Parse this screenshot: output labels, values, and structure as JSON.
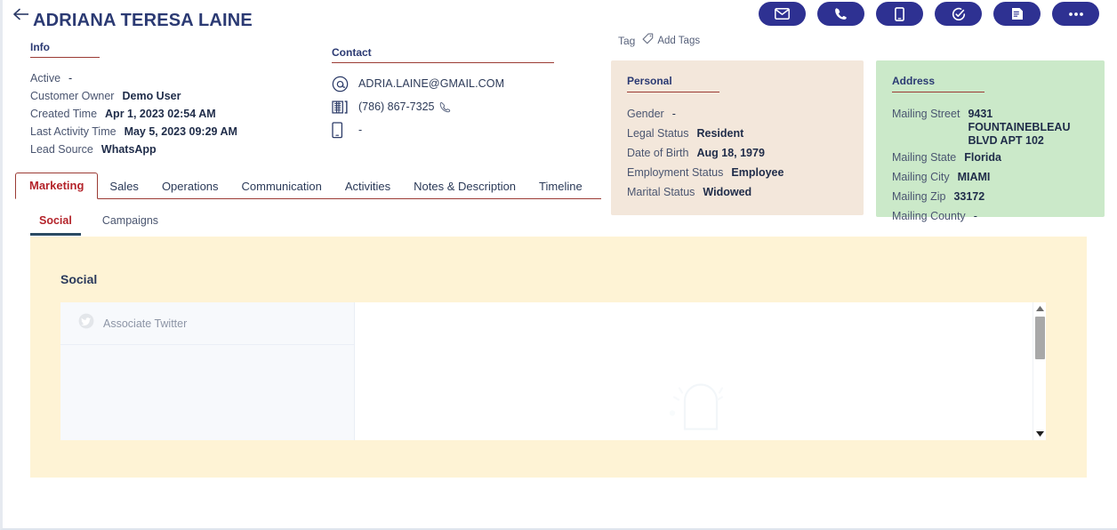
{
  "header": {
    "back_icon": "back-arrow-icon",
    "title": "ADRIANA TERESA LAINE",
    "actions": [
      {
        "name": "email-action",
        "icon": "envelope-icon",
        "label": "Email"
      },
      {
        "name": "call-action",
        "icon": "phone-icon",
        "label": "Call"
      },
      {
        "name": "sms-action",
        "icon": "mobile-icon",
        "label": "SMS"
      },
      {
        "name": "task-action",
        "icon": "task-check-icon",
        "label": "Task"
      },
      {
        "name": "note-action",
        "icon": "note-document-icon",
        "label": "Note"
      },
      {
        "name": "more-action",
        "icon": "ellipsis-icon",
        "label": "More"
      }
    ]
  },
  "info": {
    "title": "Info",
    "rows": [
      {
        "key": "Active",
        "value": "-",
        "is_dash": true
      },
      {
        "key": "Customer Owner",
        "value": "Demo User",
        "is_dash": false
      },
      {
        "key": "Created Time",
        "value": "Apr 1, 2023 02:54 AM",
        "is_dash": false
      },
      {
        "key": "Last Activity Time",
        "value": "May 5, 2023 09:29 AM",
        "is_dash": false
      },
      {
        "key": "Lead Source",
        "value": "WhatsApp",
        "is_dash": false
      }
    ]
  },
  "contact": {
    "title": "Contact",
    "email": "ADRIA.LAINE@GMAIL.COM",
    "email_icon": "at-sign-icon",
    "work_phone": "(786) 867-7325",
    "work_phone_icon": "office-phone-icon",
    "call_icon": "call-handset-icon",
    "mobile_phone": "-",
    "mobile_icon": "mobile-phone-icon"
  },
  "tag": {
    "label": "Tag",
    "add_label": "Add Tags",
    "tag_icon": "tag-icon"
  },
  "personal": {
    "title": "Personal",
    "bg_color": "#f3e7db",
    "rows": [
      {
        "key": "Gender",
        "value": "-",
        "is_dash": true
      },
      {
        "key": "Legal Status",
        "value": "Resident",
        "is_dash": false
      },
      {
        "key": "Date of Birth",
        "value": "Aug 18, 1979",
        "is_dash": false
      },
      {
        "key": "Employment Status",
        "value": "Employee",
        "is_dash": false
      },
      {
        "key": "Marital Status",
        "value": "Widowed",
        "is_dash": false
      }
    ]
  },
  "address": {
    "title": "Address",
    "bg_color": "#cbe9c9",
    "street_key": "Mailing Street",
    "street_line1": "9431 FOUNTAINEBLEAU",
    "street_line2": "BLVD APT 102",
    "rows": [
      {
        "key": "Mailing State",
        "value": "Florida",
        "is_dash": false
      },
      {
        "key": "Mailing City",
        "value": "MIAMI",
        "is_dash": false
      },
      {
        "key": "Mailing Zip",
        "value": "33172",
        "is_dash": false
      },
      {
        "key": "Mailing County",
        "value": "-",
        "is_dash": true
      }
    ]
  },
  "tabs": {
    "active": "Marketing",
    "items": [
      {
        "label": "Marketing",
        "active": true
      },
      {
        "label": "Sales",
        "active": false
      },
      {
        "label": "Operations",
        "active": false
      },
      {
        "label": "Communication",
        "active": false
      },
      {
        "label": "Activities",
        "active": false
      },
      {
        "label": "Notes & Description",
        "active": false
      },
      {
        "label": "Timeline",
        "active": false
      }
    ]
  },
  "subtabs": {
    "active": "Social",
    "items": [
      {
        "label": "Social",
        "active": true
      },
      {
        "label": "Campaigns",
        "active": false
      }
    ]
  },
  "social": {
    "heading": "Social",
    "panel_bg": "#fef3d5",
    "associate_label": "Associate Twitter",
    "associate_icon": "twitter-bird-icon",
    "scroll_up_icon": "scroll-up-arrow-icon",
    "scroll_down_icon": "scroll-down-arrow-icon"
  },
  "colors": {
    "accent_navy": "#2e3192",
    "title_navy": "#2b3a73",
    "rule_red": "#9b3b34",
    "tab_active_red": "#b4242b",
    "subtab_underline": "#2b4a63"
  }
}
